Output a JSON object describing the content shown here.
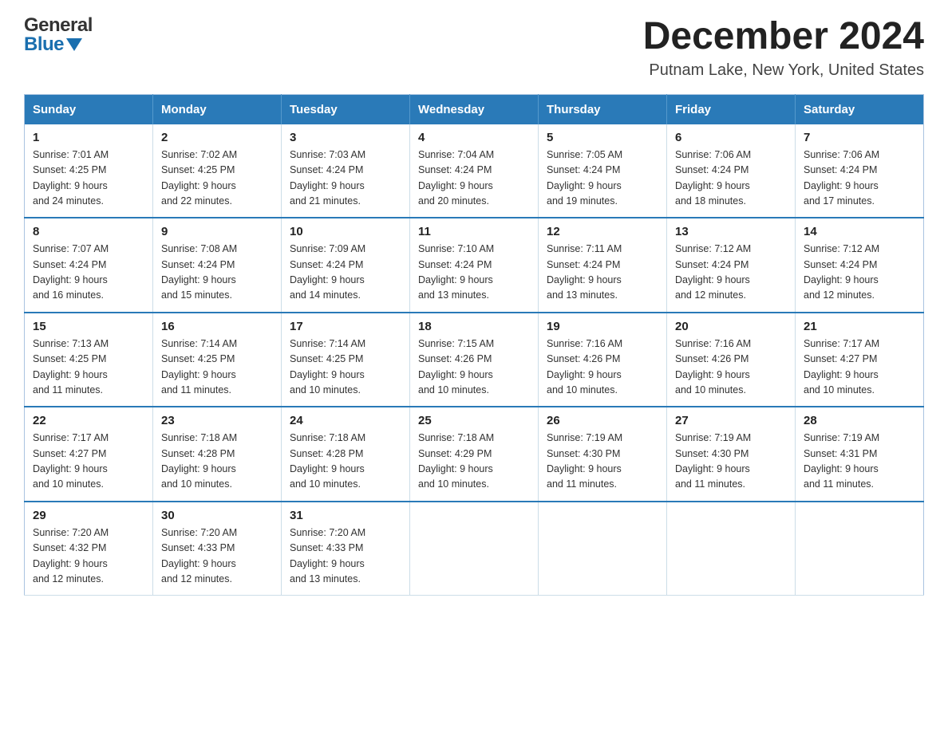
{
  "header": {
    "month_title": "December 2024",
    "location": "Putnam Lake, New York, United States",
    "logo_general": "General",
    "logo_blue": "Blue"
  },
  "days_of_week": [
    "Sunday",
    "Monday",
    "Tuesday",
    "Wednesday",
    "Thursday",
    "Friday",
    "Saturday"
  ],
  "weeks": [
    [
      {
        "num": "1",
        "sunrise": "7:01 AM",
        "sunset": "4:25 PM",
        "daylight": "9 hours and 24 minutes."
      },
      {
        "num": "2",
        "sunrise": "7:02 AM",
        "sunset": "4:25 PM",
        "daylight": "9 hours and 22 minutes."
      },
      {
        "num": "3",
        "sunrise": "7:03 AM",
        "sunset": "4:24 PM",
        "daylight": "9 hours and 21 minutes."
      },
      {
        "num": "4",
        "sunrise": "7:04 AM",
        "sunset": "4:24 PM",
        "daylight": "9 hours and 20 minutes."
      },
      {
        "num": "5",
        "sunrise": "7:05 AM",
        "sunset": "4:24 PM",
        "daylight": "9 hours and 19 minutes."
      },
      {
        "num": "6",
        "sunrise": "7:06 AM",
        "sunset": "4:24 PM",
        "daylight": "9 hours and 18 minutes."
      },
      {
        "num": "7",
        "sunrise": "7:06 AM",
        "sunset": "4:24 PM",
        "daylight": "9 hours and 17 minutes."
      }
    ],
    [
      {
        "num": "8",
        "sunrise": "7:07 AM",
        "sunset": "4:24 PM",
        "daylight": "9 hours and 16 minutes."
      },
      {
        "num": "9",
        "sunrise": "7:08 AM",
        "sunset": "4:24 PM",
        "daylight": "9 hours and 15 minutes."
      },
      {
        "num": "10",
        "sunrise": "7:09 AM",
        "sunset": "4:24 PM",
        "daylight": "9 hours and 14 minutes."
      },
      {
        "num": "11",
        "sunrise": "7:10 AM",
        "sunset": "4:24 PM",
        "daylight": "9 hours and 13 minutes."
      },
      {
        "num": "12",
        "sunrise": "7:11 AM",
        "sunset": "4:24 PM",
        "daylight": "9 hours and 13 minutes."
      },
      {
        "num": "13",
        "sunrise": "7:12 AM",
        "sunset": "4:24 PM",
        "daylight": "9 hours and 12 minutes."
      },
      {
        "num": "14",
        "sunrise": "7:12 AM",
        "sunset": "4:24 PM",
        "daylight": "9 hours and 12 minutes."
      }
    ],
    [
      {
        "num": "15",
        "sunrise": "7:13 AM",
        "sunset": "4:25 PM",
        "daylight": "9 hours and 11 minutes."
      },
      {
        "num": "16",
        "sunrise": "7:14 AM",
        "sunset": "4:25 PM",
        "daylight": "9 hours and 11 minutes."
      },
      {
        "num": "17",
        "sunrise": "7:14 AM",
        "sunset": "4:25 PM",
        "daylight": "9 hours and 10 minutes."
      },
      {
        "num": "18",
        "sunrise": "7:15 AM",
        "sunset": "4:26 PM",
        "daylight": "9 hours and 10 minutes."
      },
      {
        "num": "19",
        "sunrise": "7:16 AM",
        "sunset": "4:26 PM",
        "daylight": "9 hours and 10 minutes."
      },
      {
        "num": "20",
        "sunrise": "7:16 AM",
        "sunset": "4:26 PM",
        "daylight": "9 hours and 10 minutes."
      },
      {
        "num": "21",
        "sunrise": "7:17 AM",
        "sunset": "4:27 PM",
        "daylight": "9 hours and 10 minutes."
      }
    ],
    [
      {
        "num": "22",
        "sunrise": "7:17 AM",
        "sunset": "4:27 PM",
        "daylight": "9 hours and 10 minutes."
      },
      {
        "num": "23",
        "sunrise": "7:18 AM",
        "sunset": "4:28 PM",
        "daylight": "9 hours and 10 minutes."
      },
      {
        "num": "24",
        "sunrise": "7:18 AM",
        "sunset": "4:28 PM",
        "daylight": "9 hours and 10 minutes."
      },
      {
        "num": "25",
        "sunrise": "7:18 AM",
        "sunset": "4:29 PM",
        "daylight": "9 hours and 10 minutes."
      },
      {
        "num": "26",
        "sunrise": "7:19 AM",
        "sunset": "4:30 PM",
        "daylight": "9 hours and 11 minutes."
      },
      {
        "num": "27",
        "sunrise": "7:19 AM",
        "sunset": "4:30 PM",
        "daylight": "9 hours and 11 minutes."
      },
      {
        "num": "28",
        "sunrise": "7:19 AM",
        "sunset": "4:31 PM",
        "daylight": "9 hours and 11 minutes."
      }
    ],
    [
      {
        "num": "29",
        "sunrise": "7:20 AM",
        "sunset": "4:32 PM",
        "daylight": "9 hours and 12 minutes."
      },
      {
        "num": "30",
        "sunrise": "7:20 AM",
        "sunset": "4:33 PM",
        "daylight": "9 hours and 12 minutes."
      },
      {
        "num": "31",
        "sunrise": "7:20 AM",
        "sunset": "4:33 PM",
        "daylight": "9 hours and 13 minutes."
      },
      null,
      null,
      null,
      null
    ]
  ],
  "labels": {
    "sunrise": "Sunrise:",
    "sunset": "Sunset:",
    "daylight": "Daylight:"
  }
}
